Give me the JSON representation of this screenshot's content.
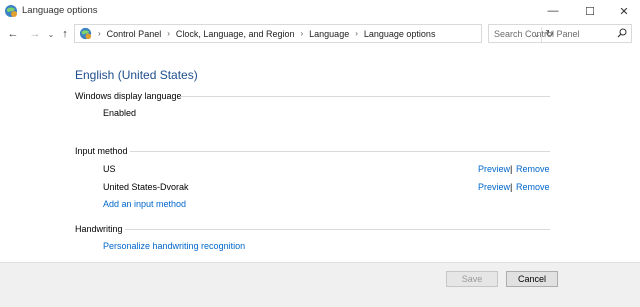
{
  "window": {
    "title": "Language options",
    "min_glyph": "—",
    "max_glyph": "☐",
    "close_glyph": "✕"
  },
  "nav": {
    "back_glyph": "←",
    "forward_glyph": "→",
    "history_glyph": "⌄",
    "up_glyph": "↑",
    "breadcrumbs": [
      "Control Panel",
      "Clock, Language, and Region",
      "Language",
      "Language options"
    ],
    "separator": "›",
    "dropdown_glyph": "⌄",
    "refresh_glyph": "↻"
  },
  "search": {
    "placeholder": "Search Control Panel"
  },
  "main": {
    "language_name": "English (United States)",
    "display_language": {
      "label": "Windows display language",
      "value": "Enabled"
    },
    "input_method": {
      "label": "Input method",
      "items": [
        {
          "name": "US",
          "preview": "Preview",
          "separator": "|",
          "remove": "Remove"
        },
        {
          "name": "United States-Dvorak",
          "preview": "Preview",
          "separator": "|",
          "remove": "Remove"
        }
      ],
      "add_link": "Add an input method"
    },
    "handwriting": {
      "label": "Handwriting",
      "link": "Personalize handwriting recognition"
    }
  },
  "footer": {
    "save_label": "Save",
    "cancel_label": "Cancel"
  },
  "colors": {
    "heading": "#1e4e8c",
    "link": "#0066cc"
  }
}
